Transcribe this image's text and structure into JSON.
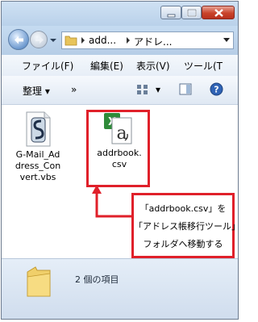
{
  "address": {
    "segments": [
      "add...",
      "アドレ..."
    ]
  },
  "menu": [
    "ファイル(F)",
    "編集(E)",
    "表示(V)",
    "ツール(T"
  ],
  "toolbar": {
    "organize": "整理 ▾",
    "more": "»",
    "view_dropdown": "▾"
  },
  "files": [
    {
      "name_lines": [
        "G-Mail_Ad",
        "dress_Con",
        "vert.vbs"
      ],
      "icon": "script-file-icon"
    },
    {
      "name_lines": [
        "addrbook.",
        "csv"
      ],
      "icon": "excel-csv-icon"
    }
  ],
  "callout": {
    "lines": [
      "「addrbook.csv」を",
      "「アドレス帳移行ツール」",
      "フォルダへ移動する"
    ]
  },
  "status": {
    "count_text": "2 個の項目"
  },
  "colors": {
    "highlight": "#e0202a",
    "titlebar": "#c4d9ef"
  }
}
